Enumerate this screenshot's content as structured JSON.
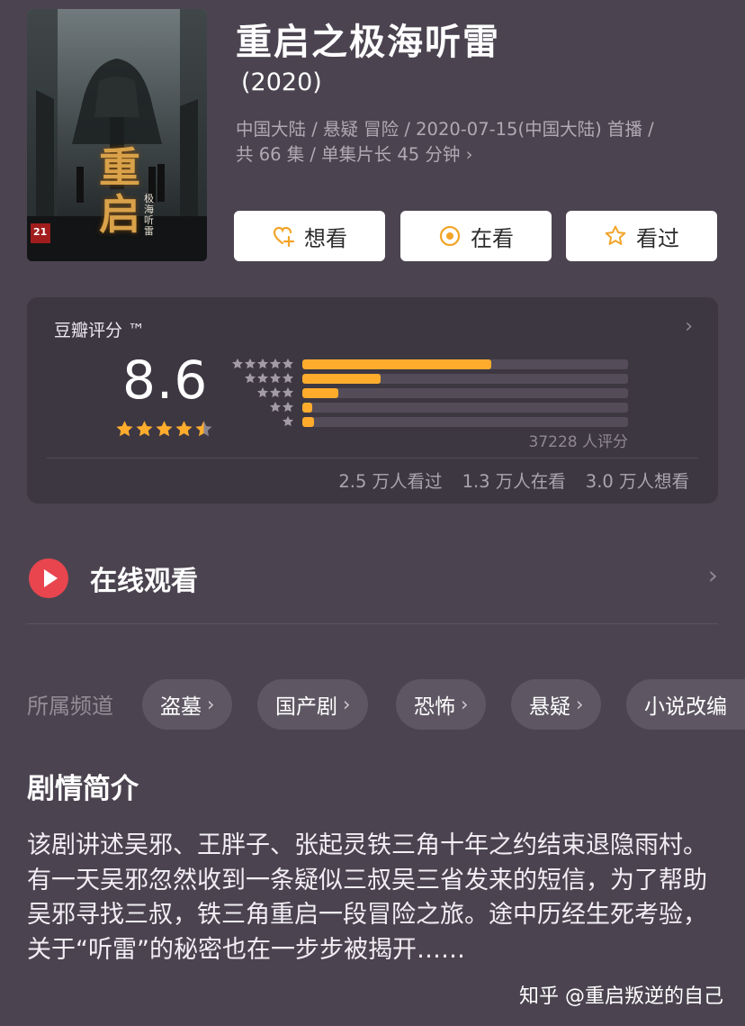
{
  "show": {
    "title": "重启之极海听雷",
    "year": "(2020)",
    "meta_line1": "中国大陆 / 悬疑 冒险 / 2020-07-15(中国大陆) 首播 /",
    "meta_line2": "共 66 集 / 单集片长 45 分钟 ",
    "meta_chevron": "›"
  },
  "poster": {
    "title_chars": [
      "重",
      "启"
    ],
    "sub_text": "极海听雷",
    "badge": "21"
  },
  "actions": [
    {
      "label": "想看",
      "icon": "heart-plus-icon"
    },
    {
      "label": "在看",
      "icon": "target-icon"
    },
    {
      "label": "看过",
      "icon": "star-outline-icon"
    }
  ],
  "rating": {
    "title": "豆瓣评分 ™",
    "chevron": "›",
    "score": "8.6",
    "stars": 4.5,
    "distribution": [
      {
        "stars": 5,
        "fraction": 0.58
      },
      {
        "stars": 4,
        "fraction": 0.24
      },
      {
        "stars": 3,
        "fraction": 0.11
      },
      {
        "stars": 2,
        "fraction": 0.03
      },
      {
        "stars": 1,
        "fraction": 0.035
      }
    ],
    "count": "37228 人评分",
    "watched": "2.5 万人看过",
    "watching": "1.3 万人在看",
    "want": "3.0 万人想看"
  },
  "online": {
    "label": "在线观看",
    "chevron": "›"
  },
  "channels": {
    "label": "所属频道",
    "items": [
      {
        "label": "盗墓",
        "chev": "›"
      },
      {
        "label": "国产剧",
        "chev": "›"
      },
      {
        "label": "恐怖",
        "chev": "›"
      },
      {
        "label": "悬疑",
        "chev": "›"
      },
      {
        "label": "小说改编",
        "chev": ""
      }
    ]
  },
  "synopsis": {
    "title": "剧情简介",
    "text": "该剧讲述吴邪、王胖子、张起灵铁三角十年之约结束退隐雨村。有一天吴邪忽然收到一条疑似三叔吴三省发来的短信，为了帮助吴邪寻找三叔，铁三角重启一段冒险之旅。途中历经生死考验，关于“听雷”的秘密也在一步步被揭开……"
  },
  "watermark": "知乎 @重启叛逆的自己",
  "colors": {
    "background": "#4b4450",
    "card": "#3d3742",
    "accent": "#ffac2d",
    "play": "#e8454f"
  }
}
